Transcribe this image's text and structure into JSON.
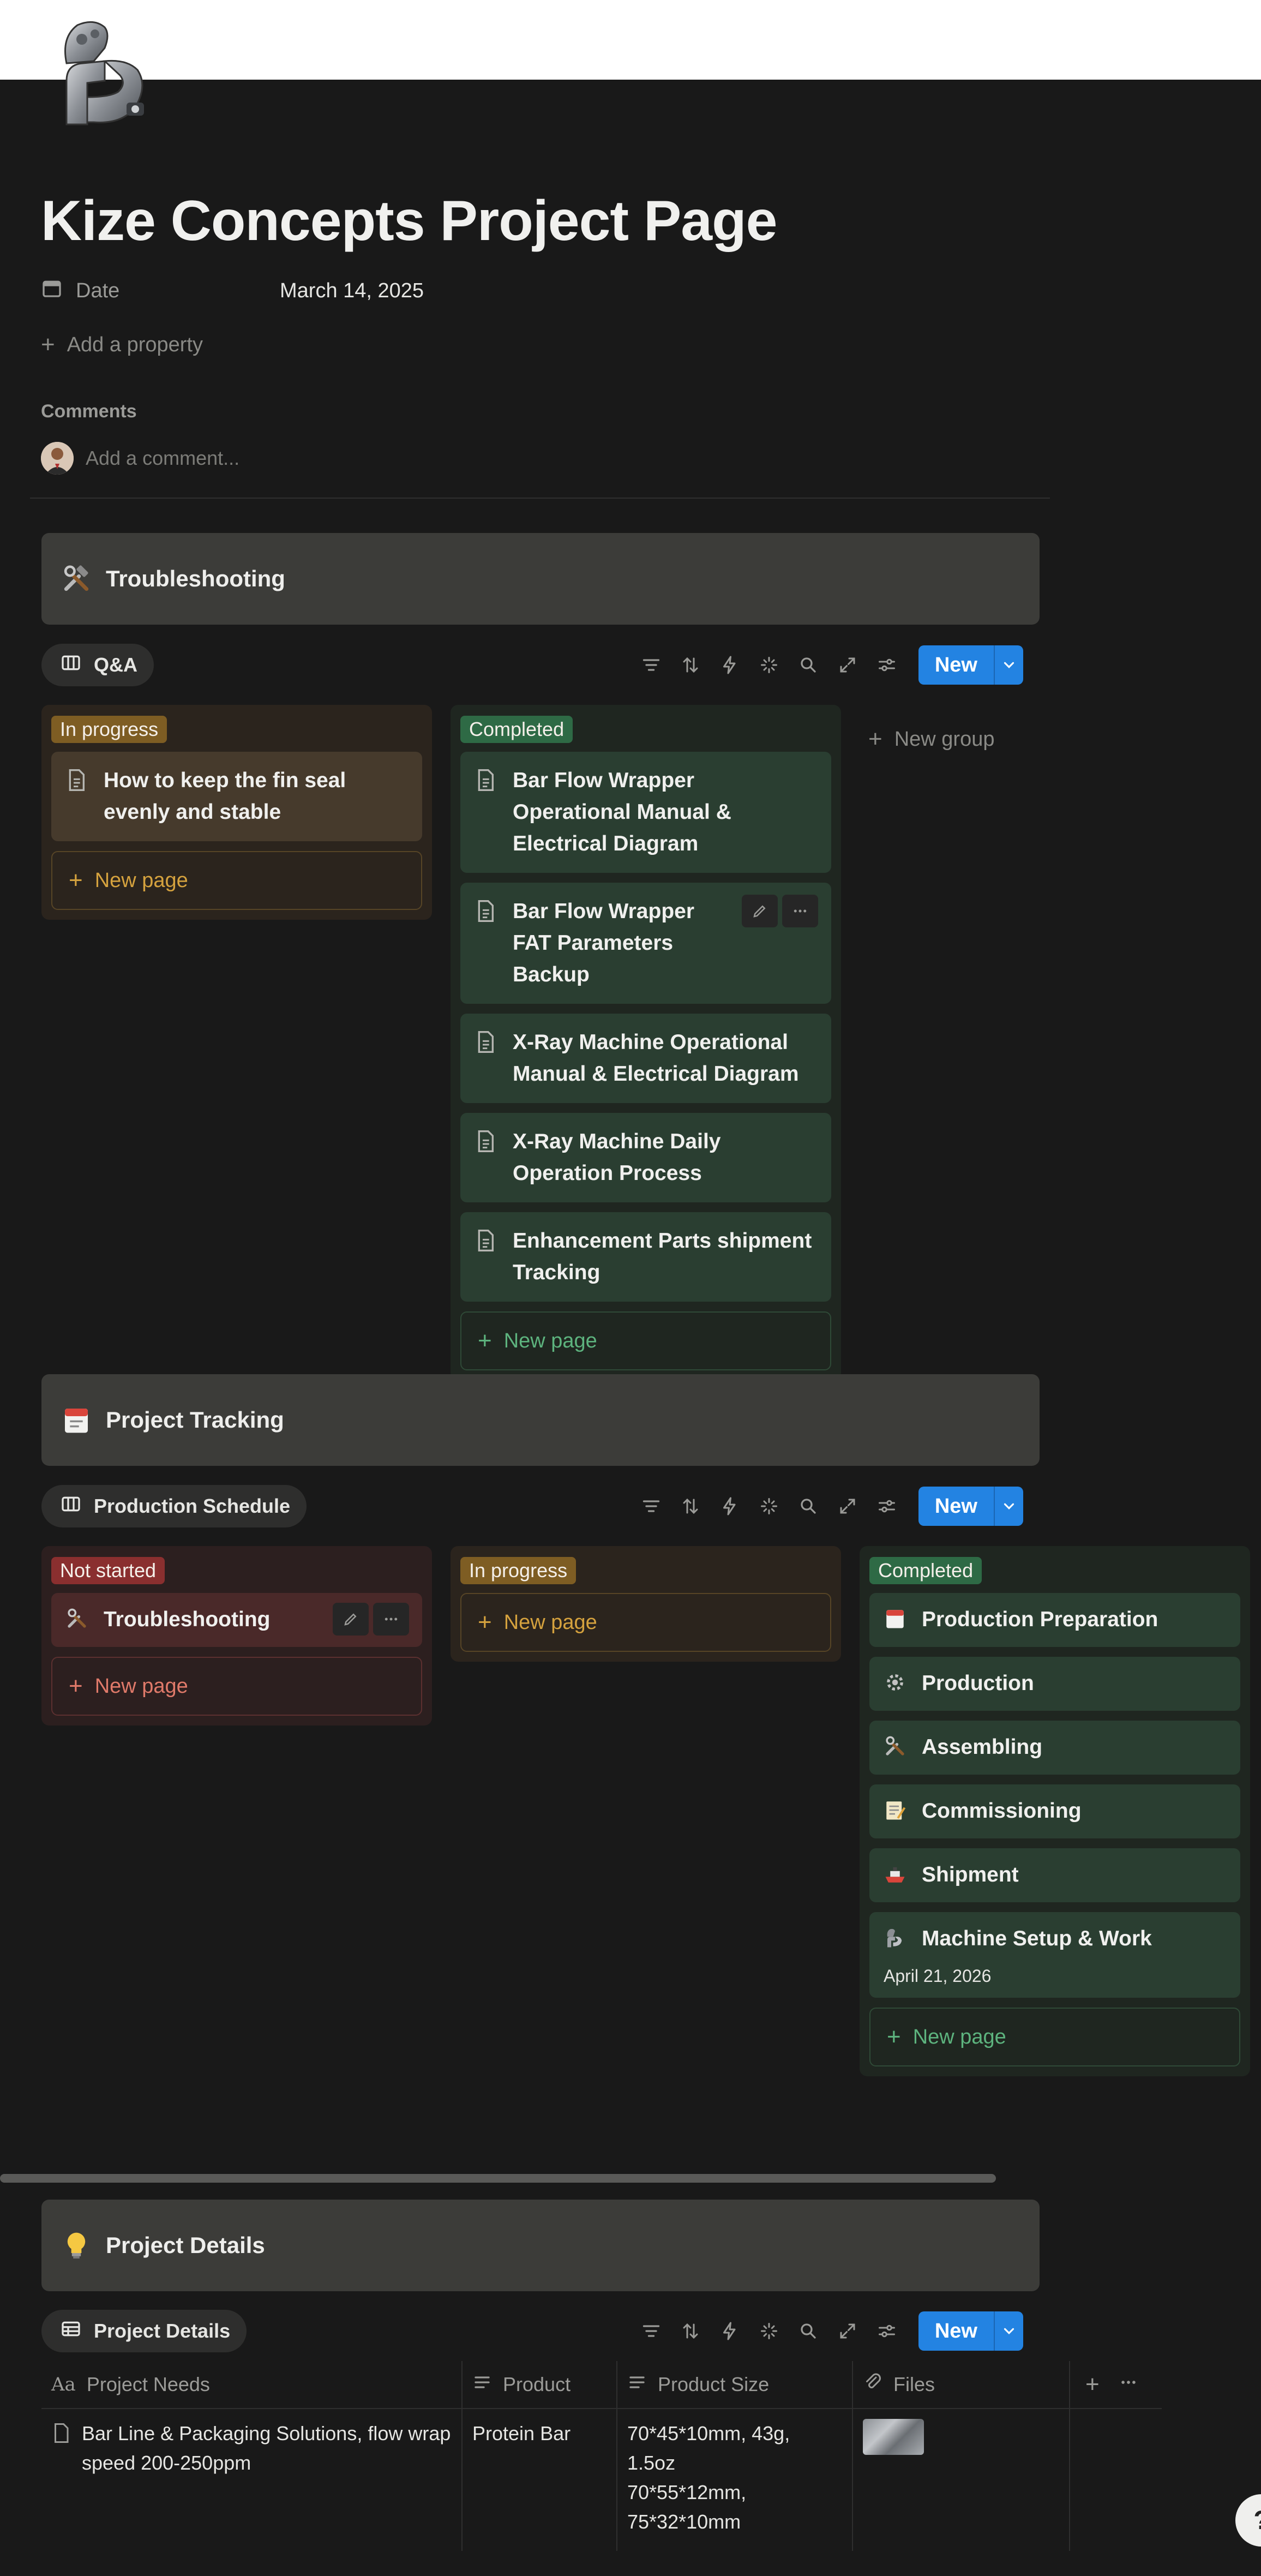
{
  "page": {
    "title": "Kize Concepts Project Page",
    "icon": "flexed-robot-arm-icon",
    "property": {
      "label": "Date",
      "value": "March 14, 2025",
      "icon": "calendar-icon"
    },
    "add_property": "Add a property",
    "comments_label": "Comments",
    "comment_placeholder": "Add a comment..."
  },
  "theme": {
    "background": "#191919",
    "accent": "#2383e2",
    "callout_bg": "#3c3c39"
  },
  "troubleshooting": {
    "callout_title": "Troubleshooting",
    "callout_icon": "hammer-wrench-icon",
    "view_tab": "Q&A",
    "new_button": "New",
    "columns": [
      {
        "status": "In progress",
        "cards": [
          "How to keep the fin seal evenly and stable"
        ],
        "new_page": "New page"
      },
      {
        "status": "Completed",
        "cards": [
          "Bar Flow Wrapper Operational Manual & Electrical Diagram",
          "Bar Flow Wrapper FAT Parameters Backup",
          "X-Ray Machine Operational Manual & Electrical Diagram",
          "X-Ray Machine Daily Operation Process",
          "Enhancement Parts shipment Tracking"
        ],
        "new_page": "New page"
      }
    ],
    "new_group": "New group"
  },
  "project_tracking": {
    "callout_title": "Project Tracking",
    "callout_icon": "calendar-page-icon",
    "view_tab": "Production Schedule",
    "new_button": "New",
    "columns": [
      {
        "status": "Not started",
        "cards": [
          {
            "title": "Troubleshooting",
            "icon": "hammer-wrench-icon"
          }
        ],
        "new_page": "New page"
      },
      {
        "status": "In progress",
        "cards": [],
        "new_page": "New page"
      },
      {
        "status": "Completed",
        "cards": [
          {
            "title": "Production Preparation",
            "icon": "calendar-page-icon"
          },
          {
            "title": "Production",
            "icon": "gear-icon"
          },
          {
            "title": "Assembling",
            "icon": "hammer-wrench-icon"
          },
          {
            "title": "Commissioning",
            "icon": "memo-icon"
          },
          {
            "title": "Shipment",
            "icon": "ship-icon"
          },
          {
            "title": "Machine Setup & Work",
            "icon": "mechanical-arm-icon",
            "date": "April 21, 2026"
          }
        ],
        "new_page": "New page"
      }
    ]
  },
  "project_details": {
    "callout_title": "Project Details",
    "callout_icon": "light-bulb-icon",
    "view_tab": "Project Details",
    "new_button": "New",
    "columns": [
      "Project Needs",
      "Product",
      "Product Size",
      "Files"
    ],
    "rows": [
      {
        "needs": "Bar Line & Packaging Solutions, flow wrap speed 200-250ppm",
        "product": "Protein Bar",
        "size_lines": [
          "70*45*10mm, 43g, 1.5oz",
          "70*55*12mm,",
          "75*32*10mm"
        ]
      }
    ]
  }
}
